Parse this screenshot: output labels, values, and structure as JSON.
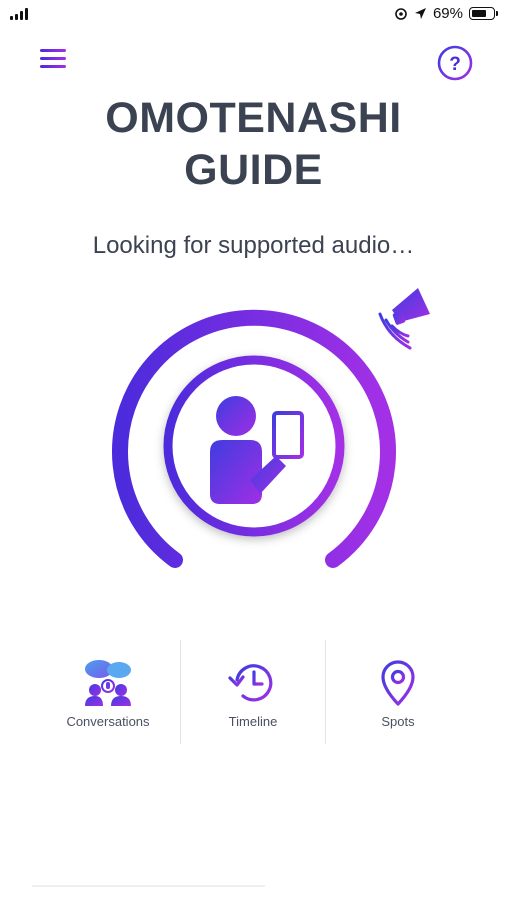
{
  "status_bar": {
    "battery_percent_text": "69%",
    "battery_level": 0.69,
    "signal_bars": 4
  },
  "header": {
    "menu_icon": "hamburger-menu-icon",
    "help_icon": "question-mark-icon",
    "help_glyph": "?"
  },
  "title_lines": [
    "OMOTENASHI",
    "GUIDE"
  ],
  "status_message": "Looking for supported audio…",
  "main_graphic": {
    "center_icon": "person-with-tablet-icon",
    "speaker_icon": "megaphone-icon"
  },
  "bottom_nav": {
    "items": [
      {
        "label": "Conversations",
        "icon": "conversations-icon"
      },
      {
        "label": "Timeline",
        "icon": "timeline-clock-icon"
      },
      {
        "label": "Spots",
        "icon": "map-pin-icon"
      }
    ]
  },
  "colors": {
    "accent_start": "#4b2bdc",
    "accent_end": "#a430e6",
    "text": "#3b4352"
  }
}
